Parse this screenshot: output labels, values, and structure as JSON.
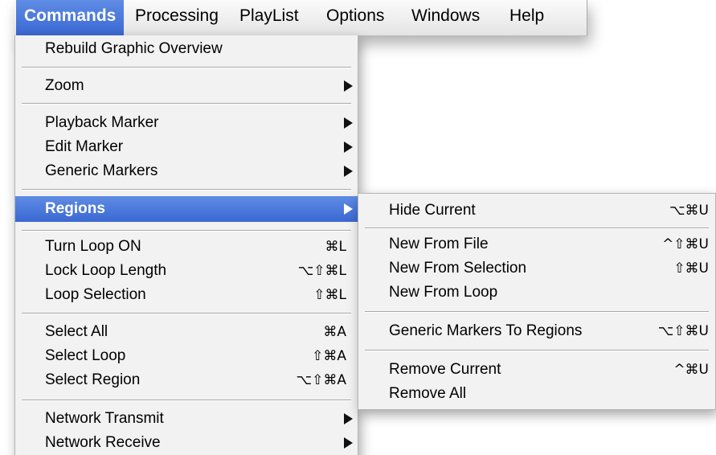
{
  "menubar": {
    "items": [
      "Commands",
      "Processing",
      "PlayList",
      "Options",
      "Windows",
      "Help"
    ]
  },
  "commands_menu": {
    "rebuild": "Rebuild Graphic Overview",
    "zoom": "Zoom",
    "playback_marker": "Playback Marker",
    "edit_marker": "Edit Marker",
    "generic_markers": "Generic Markers",
    "regions": "Regions",
    "turn_loop_on": {
      "label": "Turn Loop ON",
      "shortcut": "⌘L"
    },
    "lock_loop_length": {
      "label": "Lock Loop Length",
      "shortcut": "⌥⇧⌘L"
    },
    "loop_selection": {
      "label": "Loop Selection",
      "shortcut": "⇧⌘L"
    },
    "select_all": {
      "label": "Select All",
      "shortcut": "⌘A"
    },
    "select_loop": {
      "label": "Select Loop",
      "shortcut": "⇧⌘A"
    },
    "select_region": {
      "label": "Select Region",
      "shortcut": "⌥⇧⌘A"
    },
    "network_transmit": "Network Transmit",
    "network_receive": "Network Receive"
  },
  "regions_menu": {
    "hide_current": {
      "label": "Hide Current",
      "shortcut": "⌥⌘U"
    },
    "new_from_file": {
      "label": "New From File",
      "shortcut": "^⇧⌘U"
    },
    "new_from_selection": {
      "label": "New From Selection",
      "shortcut": "⇧⌘U"
    },
    "new_from_loop": {
      "label": "New From Loop",
      "shortcut": ""
    },
    "generic_to_regions": {
      "label": "Generic Markers To Regions",
      "shortcut": "⌥⇧⌘U"
    },
    "remove_current": {
      "label": "Remove Current",
      "shortcut": "^⌘U"
    },
    "remove_all": {
      "label": "Remove All",
      "shortcut": ""
    }
  },
  "colors": {
    "highlight": "#3b68d2",
    "menu_bg": "#f2f2f2"
  }
}
